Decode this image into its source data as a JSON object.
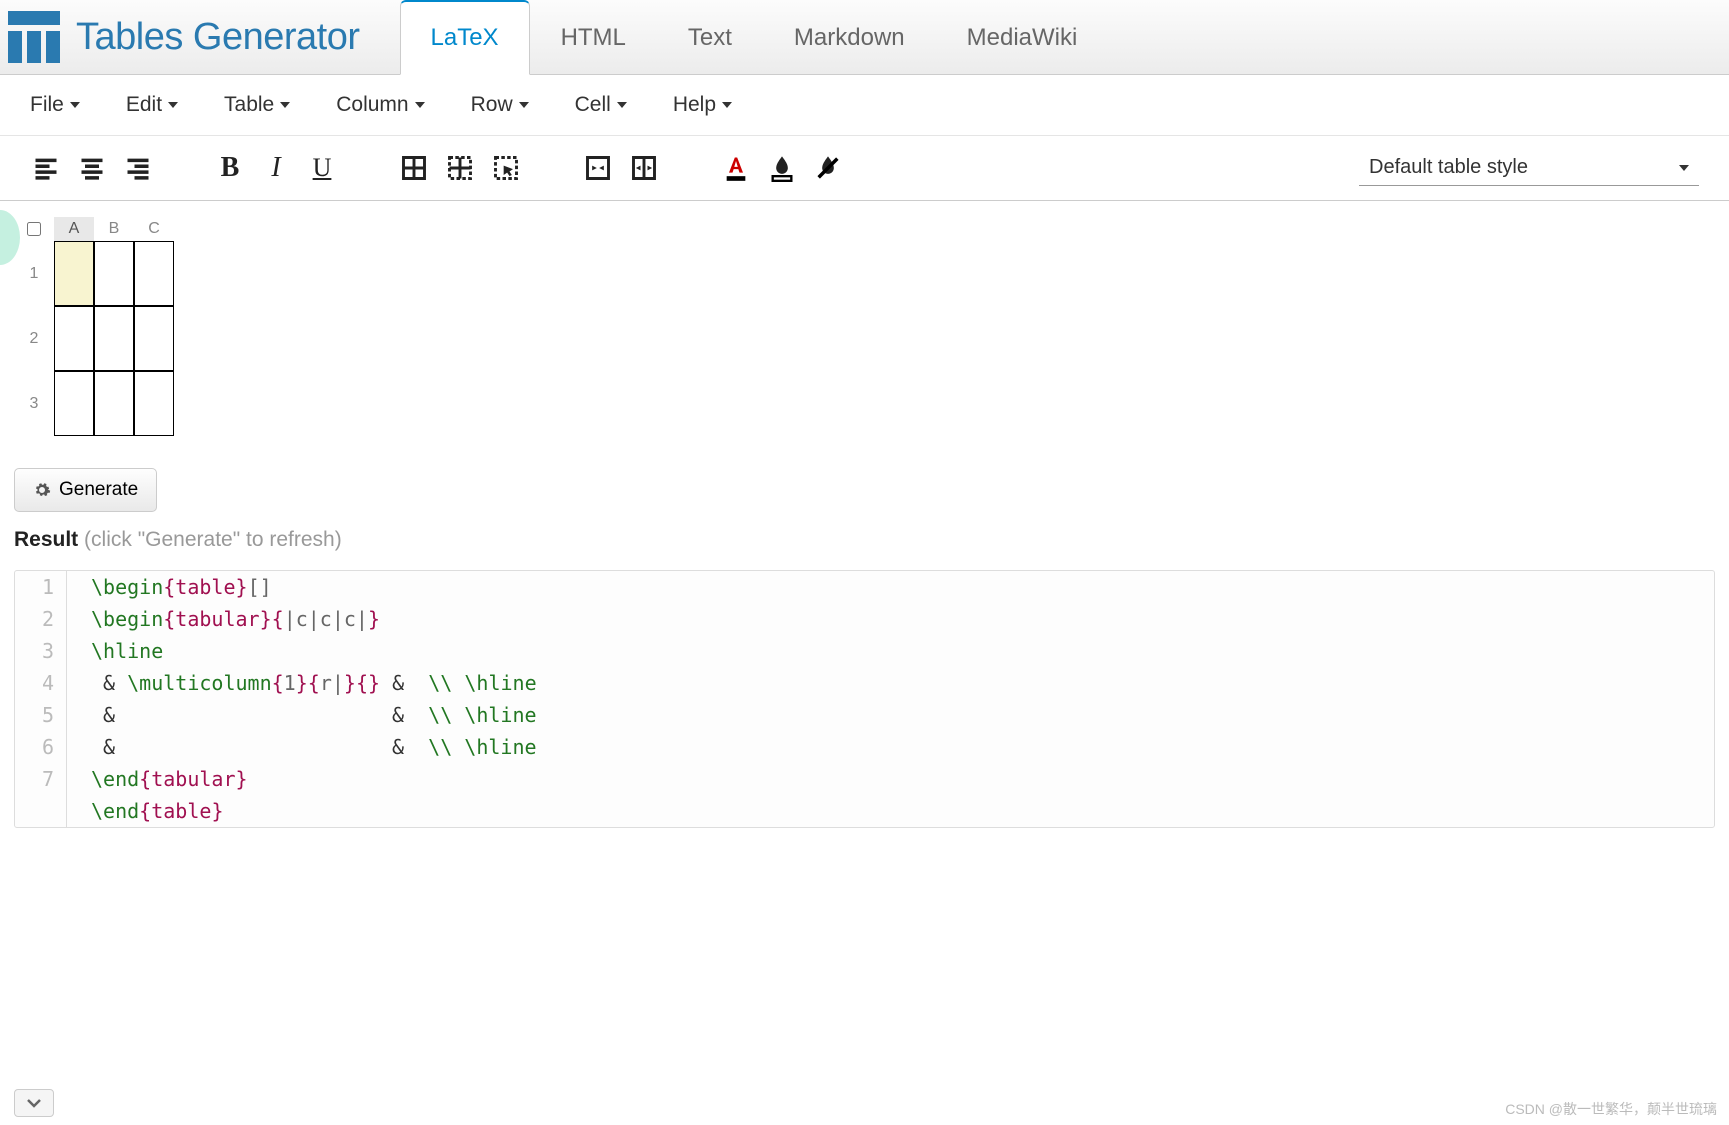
{
  "brand": "Tables Generator",
  "tabs": [
    "LaTeX",
    "HTML",
    "Text",
    "Markdown",
    "MediaWiki"
  ],
  "activeTab": 0,
  "menu": [
    "File",
    "Edit",
    "Table",
    "Column",
    "Row",
    "Cell",
    "Help"
  ],
  "styleSelect": "Default table style",
  "grid": {
    "cols": [
      "A",
      "B",
      "C"
    ],
    "rows": [
      "1",
      "2",
      "3"
    ],
    "selectedCell": [
      0,
      0
    ],
    "selectedCol": 0
  },
  "generateLabel": "Generate",
  "result": {
    "label": "Result",
    "hint": "(click \"Generate\" to refresh)"
  },
  "code": [
    {
      "n": "1",
      "t": [
        [
          "cmd",
          "\\begin"
        ],
        [
          "brace",
          "{"
        ],
        [
          "arg",
          "table"
        ],
        [
          "brace",
          "}"
        ],
        [
          "spec",
          "[]"
        ]
      ]
    },
    {
      "n": "2",
      "t": [
        [
          "cmd",
          "\\begin"
        ],
        [
          "brace",
          "{"
        ],
        [
          "arg",
          "tabular"
        ],
        [
          "brace",
          "}"
        ],
        [
          "brace",
          "{"
        ],
        [
          "spec",
          "|c|c|c|"
        ],
        [
          "brace",
          "}"
        ]
      ]
    },
    {
      "n": "3",
      "t": [
        [
          "cmd",
          "\\hline"
        ]
      ]
    },
    {
      "n": "4",
      "t": [
        [
          "txt",
          " & "
        ],
        [
          "cmd",
          "\\multicolumn"
        ],
        [
          "brace",
          "{"
        ],
        [
          "spec",
          "1"
        ],
        [
          "brace",
          "}"
        ],
        [
          "brace",
          "{"
        ],
        [
          "spec",
          "r|"
        ],
        [
          "brace",
          "}"
        ],
        [
          "brace",
          "{"
        ],
        [
          "brace",
          "}"
        ],
        [
          "txt",
          " &  "
        ],
        [
          "cmd",
          "\\\\"
        ],
        [
          "txt",
          " "
        ],
        [
          "cmd",
          "\\hline"
        ]
      ]
    },
    {
      "n": "5",
      "t": [
        [
          "txt",
          " &                       &  "
        ],
        [
          "cmd",
          "\\\\"
        ],
        [
          "txt",
          " "
        ],
        [
          "cmd",
          "\\hline"
        ]
      ]
    },
    {
      "n": "6",
      "t": [
        [
          "txt",
          " &                       &  "
        ],
        [
          "cmd",
          "\\\\"
        ],
        [
          "txt",
          " "
        ],
        [
          "cmd",
          "\\hline"
        ]
      ]
    },
    {
      "n": "7",
      "t": [
        [
          "cmd",
          "\\end"
        ],
        [
          "brace",
          "{"
        ],
        [
          "arg",
          "tabular"
        ],
        [
          "brace",
          "}"
        ]
      ]
    },
    {
      "n": "",
      "t": [
        [
          "cmd",
          "\\end"
        ],
        [
          "brace",
          "{"
        ],
        [
          "arg",
          "table"
        ],
        [
          "brace",
          "}"
        ]
      ]
    }
  ],
  "watermark": "CSDN @散一世繁华，颠半世琉璃"
}
